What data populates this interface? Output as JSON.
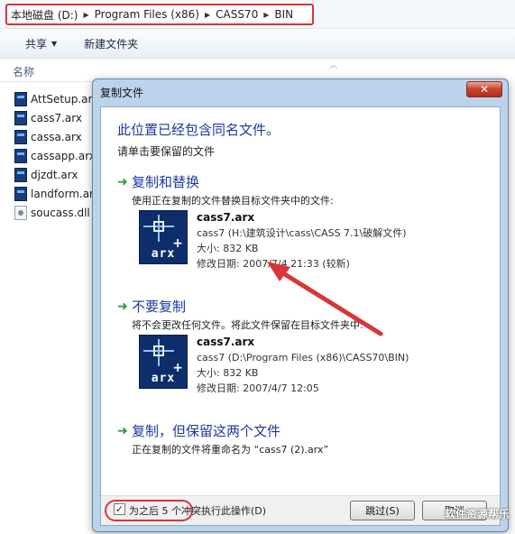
{
  "explorer": {
    "breadcrumb": [
      "本地磁盘 (D:)",
      "Program Files (x86)",
      "CASS70",
      "BIN"
    ],
    "toolbar": {
      "share_label": "共享",
      "new_folder_label": "新建文件夹"
    },
    "column_header": "名称",
    "files": [
      {
        "name": "AttSetup.arx",
        "icon": "arx-file-icon"
      },
      {
        "name": "cass7.arx",
        "icon": "arx-file-icon"
      },
      {
        "name": "cassa.arx",
        "icon": "arx-file-icon"
      },
      {
        "name": "cassapp.arx",
        "icon": "arx-file-icon"
      },
      {
        "name": "djzdt.arx",
        "icon": "arx-file-icon"
      },
      {
        "name": "landform.arx",
        "icon": "arx-file-icon"
      },
      {
        "name": "soucass.dll",
        "icon": "dll-file-icon"
      }
    ]
  },
  "dialog": {
    "title": "复制文件",
    "close_label": "✕",
    "headline": "此位置已经包含同名文件。",
    "subline": "请单击要保留的文件",
    "option_replace": {
      "title": "复制和替换",
      "desc": "使用正在复制的文件替换目标文件夹中的文件:",
      "file": {
        "name": "cass7.arx",
        "path": "cass7 (H:\\建筑设计\\cass\\CASS 7.1\\破解文件)",
        "size": "大小: 832 KB",
        "modified": "修改日期: 2007/7/4 21:33 (较新)",
        "icon_text": "arx"
      }
    },
    "option_skip": {
      "title": "不要复制",
      "desc": "将不会更改任何文件。将此文件保留在目标文件夹中:",
      "file": {
        "name": "cass7.arx",
        "path": "cass7 (D:\\Program Files (x86)\\CASS70\\BIN)",
        "size": "大小: 832 KB",
        "modified": "修改日期: 2007/4/7 12:05",
        "icon_text": "arx"
      }
    },
    "option_keep_both": {
      "title": "复制，但保留这两个文件",
      "desc": "正在复制的文件将重命名为 “cass7 (2).arx”"
    },
    "checkbox": {
      "checked": true,
      "mark": "✓",
      "label": "为之后 5 个冲突执行此操作(D)"
    },
    "skip_button": "跳过(S)",
    "cancel_button": "取消"
  },
  "watermark": "软件资源帮乐",
  "colors": {
    "annotation_red": "#d9353a",
    "link_blue": "#1b3aa0",
    "arrow_green": "#2a9a3a"
  }
}
